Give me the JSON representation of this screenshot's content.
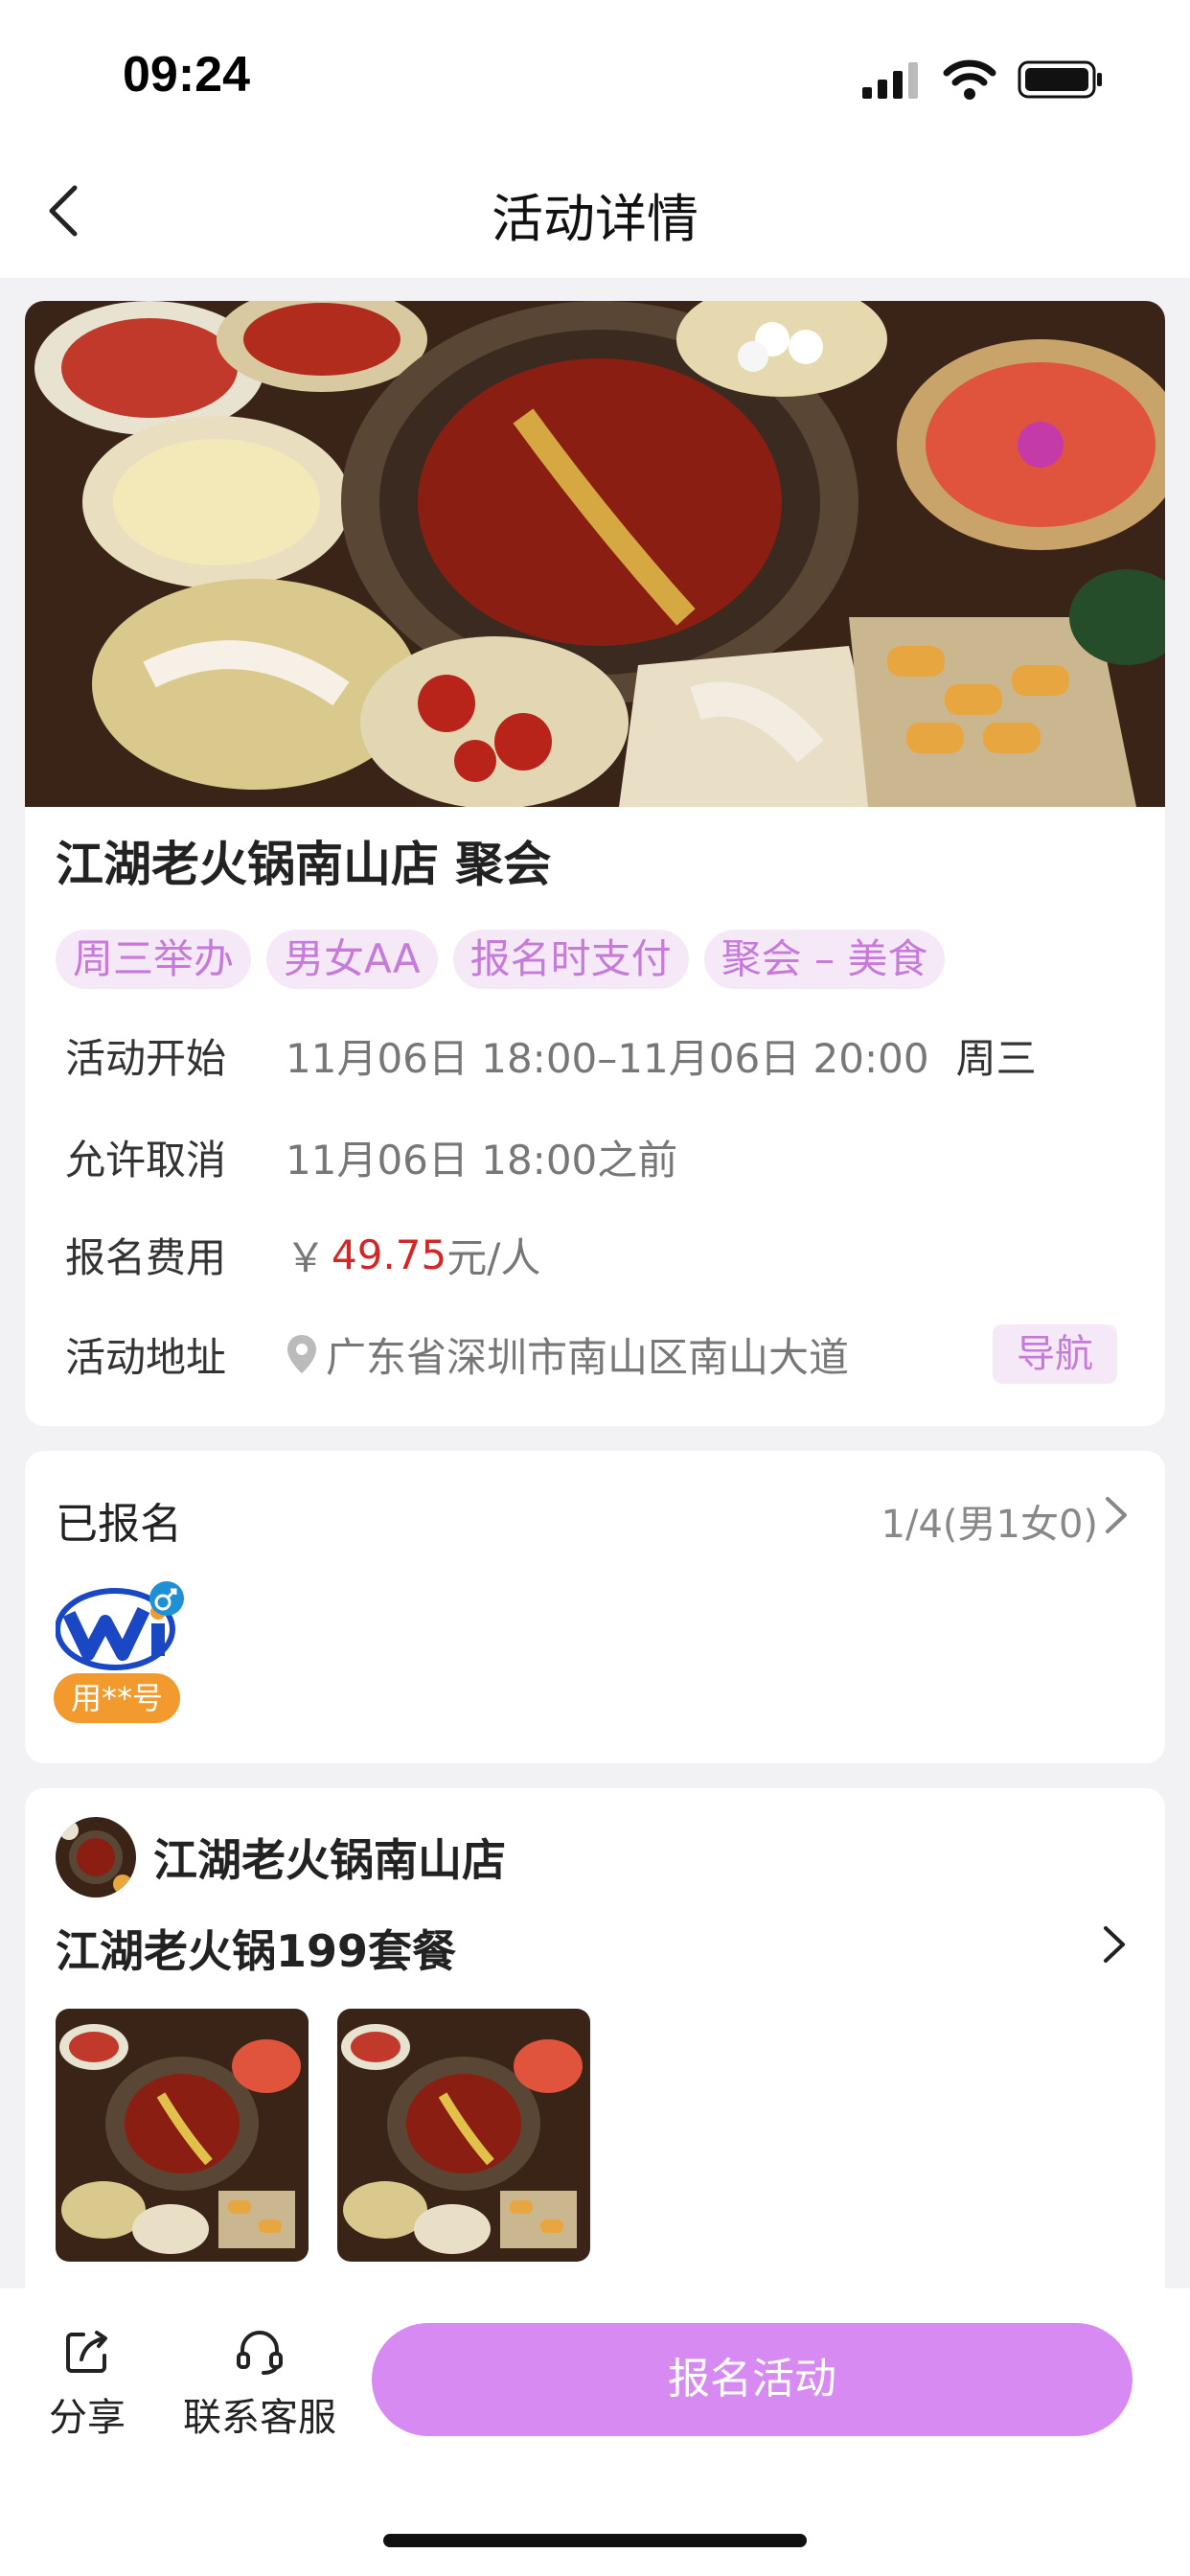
{
  "status_bar": {
    "time": "09:24"
  },
  "nav": {
    "title": "活动详情"
  },
  "event": {
    "title": "江湖老火锅南山店 聚会",
    "tags": [
      "周三举办",
      "男女AA",
      "报名时支付",
      "聚会 – 美食"
    ],
    "start": {
      "label": "活动开始",
      "value": "11月06日 18:00–11月06日 20:00",
      "weekday": "周三"
    },
    "cancel": {
      "label": "允许取消",
      "value": "11月06日 18:00之前"
    },
    "fee": {
      "label": "报名费用",
      "currency": "￥",
      "amount": "49.75",
      "unit": "元/人"
    },
    "address": {
      "label": "活动地址",
      "value": "广东省深圳市南山区南山大道",
      "nav_label": "导航"
    }
  },
  "signup": {
    "title": "已报名",
    "count": "1/4(男1女0)",
    "member_name": "用**号"
  },
  "store": {
    "name": "江湖老火锅南山店",
    "package": "江湖老火锅199套餐"
  },
  "bottom": {
    "share_label": "分享",
    "service_label": "联系客服",
    "signup_button": "报名活动"
  },
  "colors": {
    "accent": "#d78bf2",
    "tag_bg": "#f6e9f7",
    "tag_text": "#c67ad9",
    "price": "#d42626",
    "badge": "#f29a2e"
  }
}
